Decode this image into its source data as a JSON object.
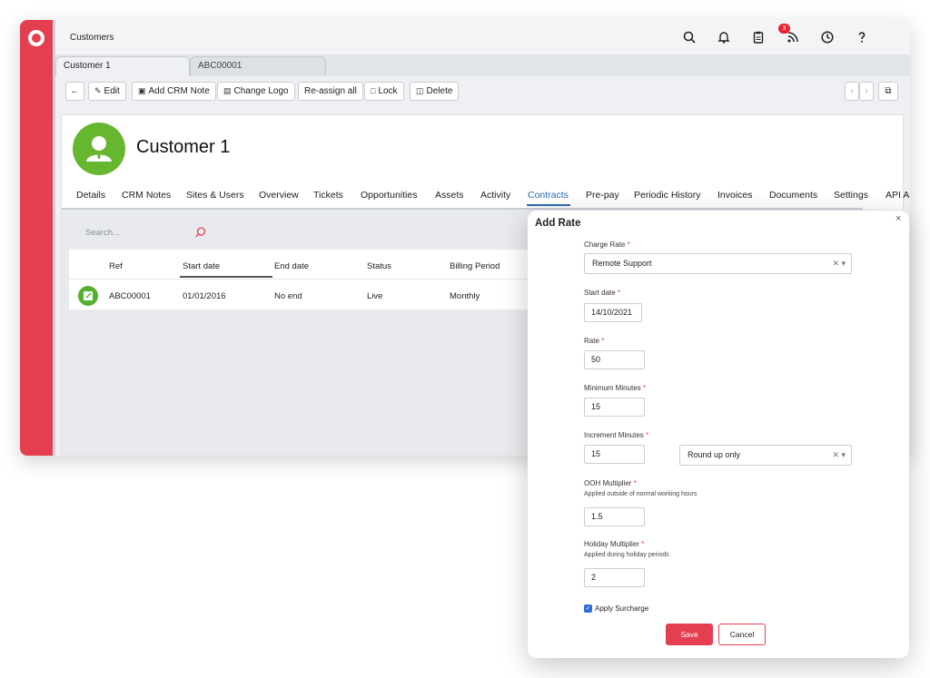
{
  "app": {
    "title": "Customers",
    "notifications_count": "3"
  },
  "doc_tabs": [
    "Customer 1",
    "ABC00001"
  ],
  "toolbar": {
    "edit": "Edit",
    "add_note": "Add CRM Note",
    "change_logo": "Change Logo",
    "reassign": "Re-assign all",
    "lock": "Lock",
    "delete": "Delete"
  },
  "customer": {
    "name": "Customer 1"
  },
  "nav_tabs": [
    "Details",
    "CRM Notes",
    "Sites & Users",
    "Overview",
    "Tickets",
    "Opportunities",
    "Assets",
    "Activity",
    "Contracts",
    "Pre-pay",
    "Periodic History",
    "Invoices",
    "Documents",
    "Settings",
    "API A"
  ],
  "active_tab": "Contracts",
  "search": {
    "placeholder": "Search..."
  },
  "contracts_table": {
    "headers": [
      "Ref",
      "Start date",
      "End date",
      "Status",
      "Billing Period"
    ],
    "rows": [
      {
        "ref": "ABC00001",
        "start": "01/01/2016",
        "end": "No end",
        "status": "Live",
        "billing": "Monthly"
      }
    ]
  },
  "modal": {
    "title": "Add Rate",
    "close": "×",
    "charge_rate_label": "Charge Rate",
    "charge_rate_value": "Remote Support",
    "start_date_label": "Start date",
    "start_date_value": "14/10/2021",
    "rate_label": "Rate",
    "rate_value": "50",
    "min_minutes_label": "Minimum Minutes",
    "min_minutes_value": "15",
    "increment_label": "Increment Minutes",
    "increment_value": "15",
    "rounding_value": "Round up only",
    "ooh_label": "OOH Multiplier",
    "ooh_hint": "Applied outside of normal working hours",
    "ooh_value": "1.5",
    "holiday_label": "Holiday Multiplier",
    "holiday_hint": "Applied during holiday periods",
    "holiday_value": "2",
    "surcharge_label": "Apply Surcharge",
    "save": "Save",
    "cancel": "Cancel",
    "required_mark": "*"
  },
  "colors": {
    "brand_red": "#e43f51",
    "accent_blue": "#2b6cb0",
    "avatar_green": "#66b72f"
  }
}
